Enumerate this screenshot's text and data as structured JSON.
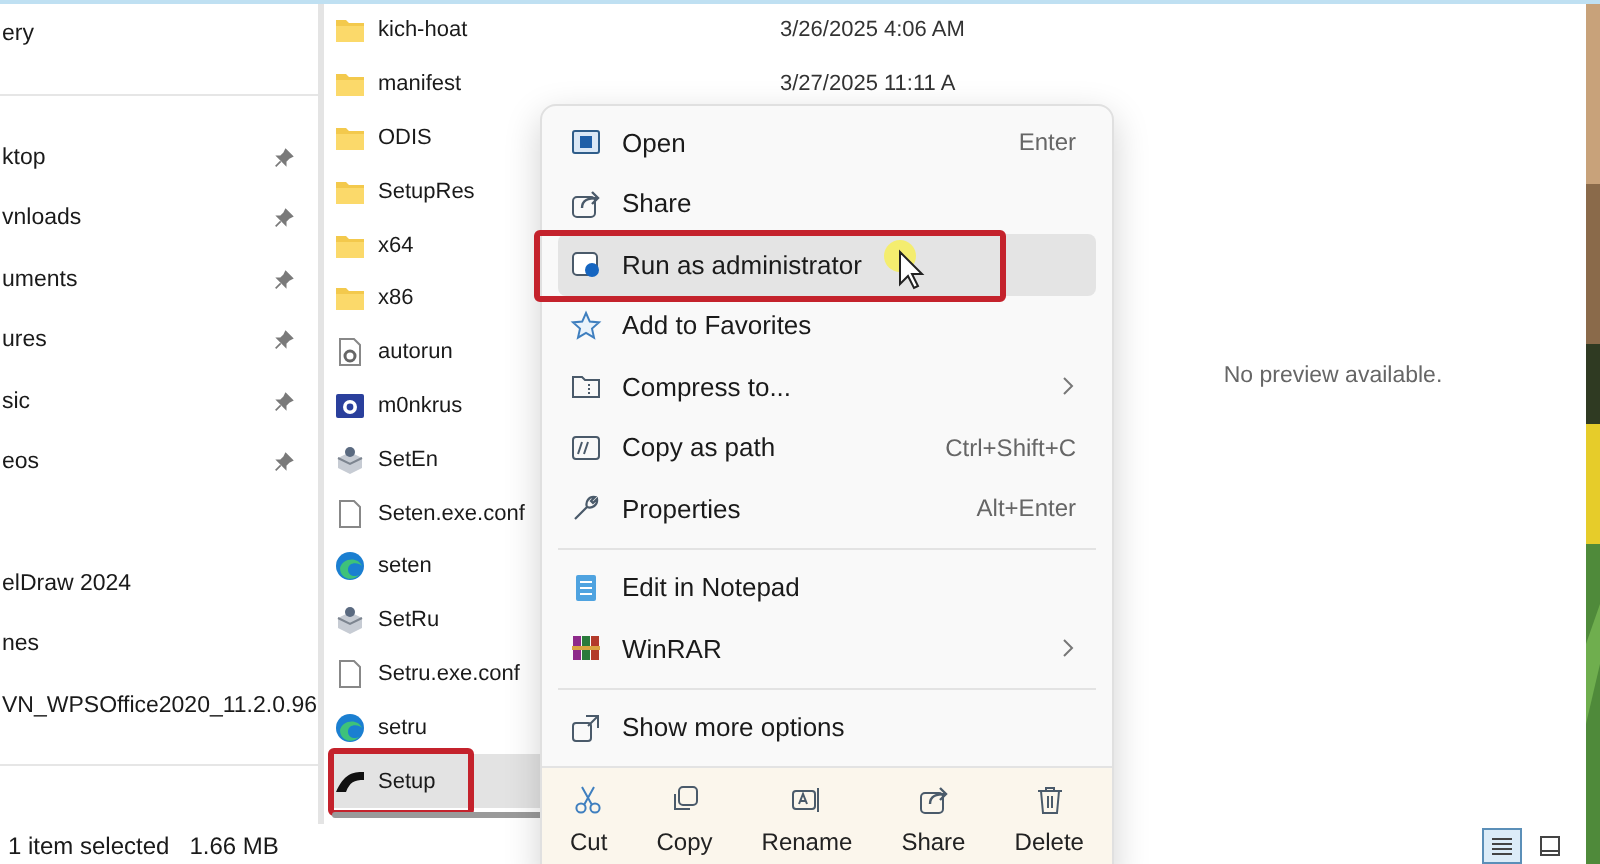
{
  "sidebar": {
    "sections": [
      {
        "items": [
          {
            "label": "ery",
            "pinned": false
          }
        ]
      },
      {
        "items": [
          {
            "label": "ktop",
            "pinned": true
          },
          {
            "label": "vnloads",
            "pinned": true
          },
          {
            "label": "uments",
            "pinned": true
          },
          {
            "label": "ures",
            "pinned": true
          },
          {
            "label": "sic",
            "pinned": true
          },
          {
            "label": "eos",
            "pinned": true
          }
        ]
      },
      {
        "items": [
          {
            "label": "elDraw 2024",
            "pinned": false
          },
          {
            "label": "nes",
            "pinned": false
          },
          {
            "label": "VN_WPSOffice2020_11.2.0.96",
            "pinned": false
          }
        ]
      }
    ]
  },
  "files": [
    {
      "name": "kich-hoat",
      "kind": "folder",
      "date": "3/26/2025 4:06 AM",
      "selected": false,
      "highlighted": false
    },
    {
      "name": "manifest",
      "kind": "folder",
      "date": "3/27/2025 11:11 A",
      "selected": false,
      "highlighted": false
    },
    {
      "name": "ODIS",
      "kind": "folder",
      "selected": false,
      "highlighted": false
    },
    {
      "name": "SetupRes",
      "kind": "folder",
      "selected": false,
      "highlighted": false
    },
    {
      "name": "x64",
      "kind": "folder",
      "selected": false,
      "highlighted": false
    },
    {
      "name": "x86",
      "kind": "folder",
      "selected": false,
      "highlighted": false
    },
    {
      "name": "autorun",
      "kind": "settings-file",
      "selected": false,
      "highlighted": false
    },
    {
      "name": "m0nkrus",
      "kind": "app",
      "selected": false,
      "highlighted": false
    },
    {
      "name": "SetEn",
      "kind": "installer",
      "selected": false,
      "highlighted": false
    },
    {
      "name": "Seten.exe.conf",
      "kind": "file",
      "selected": false,
      "highlighted": false
    },
    {
      "name": "seten",
      "kind": "browser",
      "selected": false,
      "highlighted": false
    },
    {
      "name": "SetRu",
      "kind": "installer",
      "selected": false,
      "highlighted": false
    },
    {
      "name": "Setru.exe.conf",
      "kind": "file",
      "selected": false,
      "highlighted": false
    },
    {
      "name": "setru",
      "kind": "browser",
      "selected": false,
      "highlighted": false
    },
    {
      "name": "Setup",
      "kind": "setup",
      "selected": true,
      "highlighted": true
    }
  ],
  "context_menu": {
    "groups": [
      [
        {
          "label": "Open",
          "shortcut": "Enter",
          "submenu": false,
          "hovered": false,
          "highlighted": false
        },
        {
          "label": "Share",
          "submenu": false,
          "hovered": false,
          "highlighted": false
        },
        {
          "label": "Run as administrator",
          "submenu": false,
          "hovered": true,
          "highlighted": true
        },
        {
          "label": "Add to Favorites",
          "submenu": false,
          "hovered": false,
          "highlighted": false
        },
        {
          "label": "Compress to...",
          "submenu": true,
          "hovered": false,
          "highlighted": false
        },
        {
          "label": "Copy as path",
          "shortcut": "Ctrl+Shift+C",
          "submenu": false,
          "hovered": false,
          "highlighted": false
        },
        {
          "label": "Properties",
          "shortcut": "Alt+Enter",
          "submenu": false,
          "hovered": false,
          "highlighted": false
        }
      ],
      [
        {
          "label": "Edit in Notepad",
          "submenu": false,
          "hovered": false,
          "highlighted": false
        },
        {
          "label": "WinRAR",
          "submenu": true,
          "hovered": false,
          "highlighted": false
        }
      ],
      [
        {
          "label": "Show more options",
          "submenu": false,
          "hovered": false,
          "highlighted": false
        }
      ]
    ],
    "actions": [
      {
        "label": "Cut"
      },
      {
        "label": "Copy"
      },
      {
        "label": "Rename"
      },
      {
        "label": "Share"
      },
      {
        "label": "Delete"
      }
    ]
  },
  "preview": {
    "message": "No preview available."
  },
  "status_bar": {
    "selection": "1 item selected",
    "size": "1.66 MB"
  },
  "view_buttons": [
    {
      "kind": "details",
      "selected": true
    },
    {
      "kind": "preview",
      "selected": false
    }
  ]
}
